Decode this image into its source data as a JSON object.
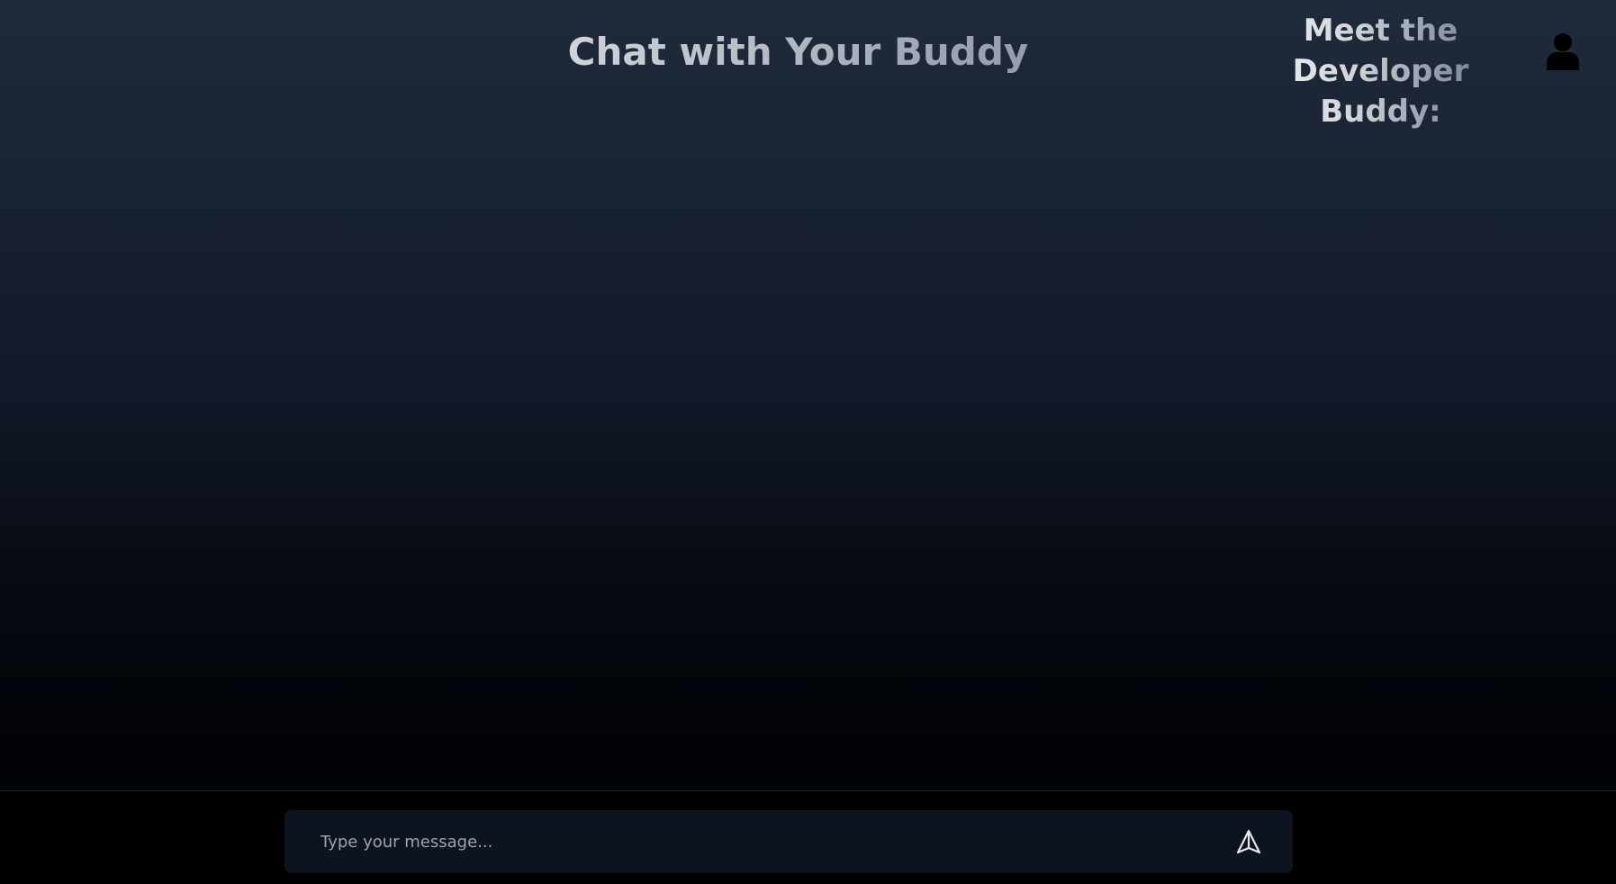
{
  "header": {
    "title": "Chat with Your Buddy",
    "developer_line1": "Meet the",
    "developer_line2": "Developer Buddy:"
  },
  "composer": {
    "placeholder": "Type your message...",
    "value": ""
  },
  "icons": {
    "developer_avatar": "user-icon",
    "send": "send-icon"
  },
  "colors": {
    "background_top": "#1f2a3b",
    "background_bottom": "#000000",
    "composer_background": "#0e1320",
    "placeholder_text": "#9ca3af"
  }
}
